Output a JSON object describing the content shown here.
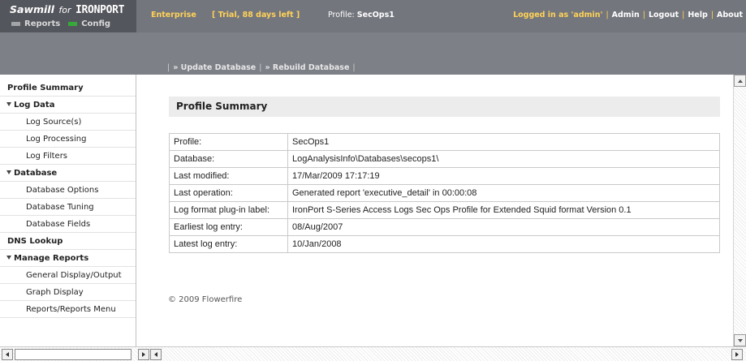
{
  "brand": {
    "name_part1": "Sawmill",
    "name_part2": "for",
    "name_part3": "IRONPORT",
    "nav": [
      {
        "label": "Reports",
        "icon": "grey-bar-icon"
      },
      {
        "label": "Config",
        "icon": "green-bar-icon"
      }
    ]
  },
  "header": {
    "edition": "Enterprise",
    "trial": "[ Trial, 88 days left ]",
    "profile_label": "Profile:",
    "profile_name": "SecOps1",
    "logged_in": "Logged in as 'admin'",
    "links": [
      "Admin",
      "Logout",
      "Help",
      "About"
    ]
  },
  "subnav": {
    "update": "» Update Database",
    "rebuild": "» Rebuild Database"
  },
  "sidebar": {
    "items": [
      {
        "label": "Profile Summary",
        "kind": "top"
      },
      {
        "label": "Log Data",
        "kind": "section"
      },
      {
        "label": "Log Source(s)",
        "kind": "sub"
      },
      {
        "label": "Log Processing",
        "kind": "sub"
      },
      {
        "label": "Log Filters",
        "kind": "sub"
      },
      {
        "label": "Database",
        "kind": "section"
      },
      {
        "label": "Database Options",
        "kind": "sub"
      },
      {
        "label": "Database Tuning",
        "kind": "sub"
      },
      {
        "label": "Database Fields",
        "kind": "sub"
      },
      {
        "label": "DNS Lookup",
        "kind": "top"
      },
      {
        "label": "Manage Reports",
        "kind": "section"
      },
      {
        "label": "General Display/Output",
        "kind": "sub"
      },
      {
        "label": "Graph Display",
        "kind": "sub"
      },
      {
        "label": "Reports/Reports Menu",
        "kind": "sub"
      }
    ]
  },
  "main": {
    "title": "Profile Summary",
    "rows": [
      {
        "key": "Profile:",
        "value": "SecOps1"
      },
      {
        "key": "Database:",
        "value": "LogAnalysisInfo\\Databases\\secops1\\"
      },
      {
        "key": "Last modified:",
        "value": "17/Mar/2009 17:17:19"
      },
      {
        "key": "Last operation:",
        "value": "Generated report 'executive_detail' in 00:00:08"
      },
      {
        "key": "Log format plug-in label:",
        "value": "IronPort S-Series Access Logs Sec Ops Profile for Extended Squid format Version 0.1"
      },
      {
        "key": "Earliest log entry:",
        "value": "08/Aug/2007"
      },
      {
        "key": "Latest log entry:",
        "value": "10/Jan/2008"
      }
    ],
    "copyright": "© 2009 Flowerfire"
  }
}
